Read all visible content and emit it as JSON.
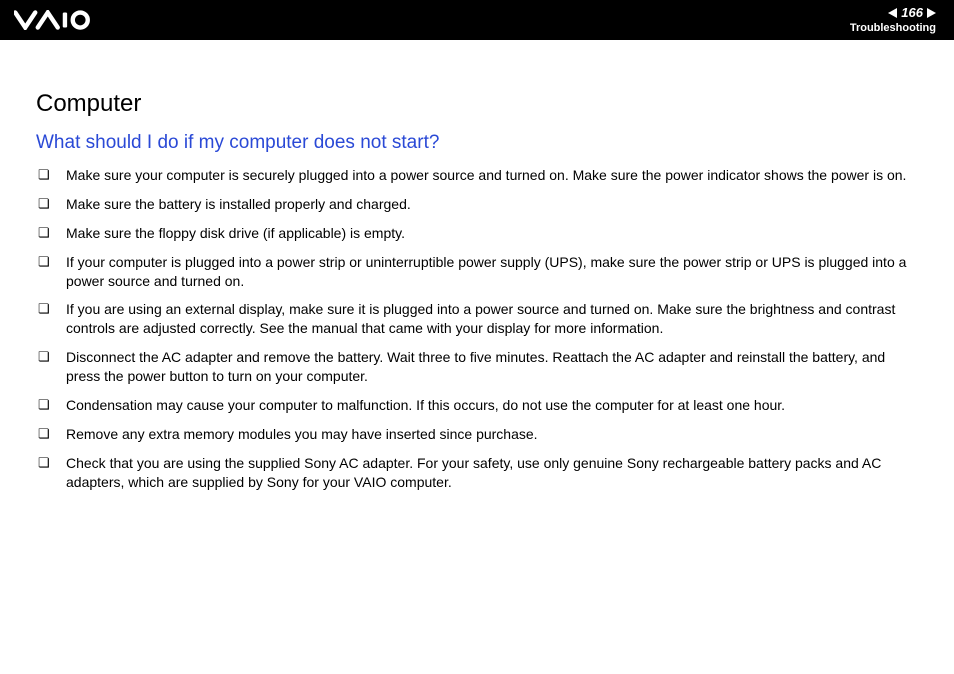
{
  "header": {
    "page_number": "166",
    "section": "Troubleshooting"
  },
  "main": {
    "title": "Computer",
    "question": "What should I do if my computer does not start?",
    "items": [
      "Make sure your computer is securely plugged into a power source and turned on. Make sure the power indicator shows the power is on.",
      "Make sure the battery is installed properly and charged.",
      "Make sure the floppy disk drive (if applicable) is empty.",
      "If your computer is plugged into a power strip or uninterruptible power supply (UPS), make sure the power strip or UPS is plugged into a power source and turned on.",
      "If you are using an external display, make sure it is plugged into a power source and turned on. Make sure the brightness and contrast controls are adjusted correctly. See the manual that came with your display for more information.",
      "Disconnect the AC adapter and remove the battery. Wait three to five minutes. Reattach the AC adapter and reinstall the battery, and press the power button to turn on your computer.",
      "Condensation may cause your computer to malfunction. If this occurs, do not use the computer for at least one hour.",
      "Remove any extra memory modules you may have inserted since purchase.",
      "Check that you are using the supplied Sony AC adapter. For your safety, use only genuine Sony rechargeable battery packs and AC adapters, which are supplied by Sony for your VAIO computer."
    ]
  }
}
